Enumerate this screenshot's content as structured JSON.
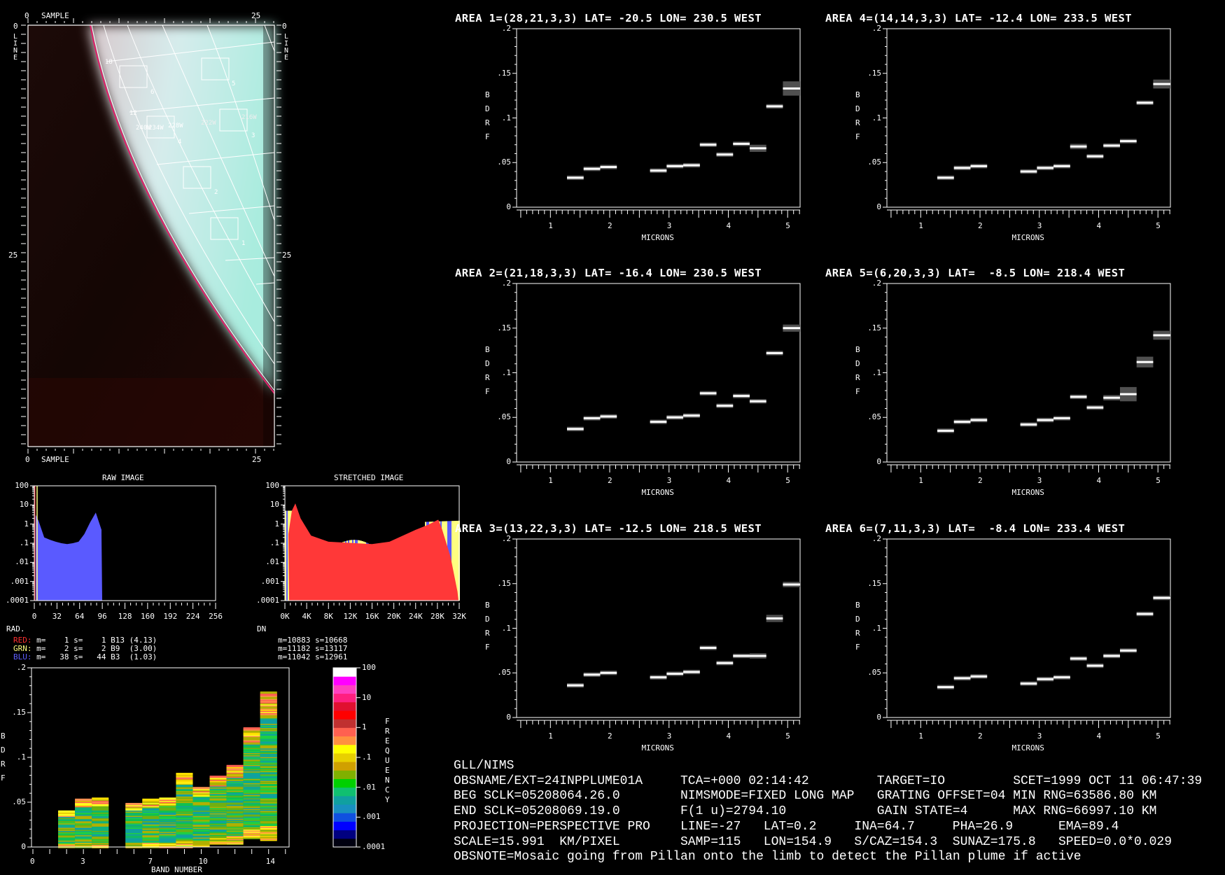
{
  "image_panel": {
    "top_label": "SAMPLE",
    "bottom_label": "SAMPLE",
    "side_label": "LINE",
    "tick_0": "0",
    "tick_25": "25",
    "grid_labels": [
      "18",
      "12",
      "240W",
      "234W",
      "228W",
      "222W",
      "216W"
    ],
    "box_labels": [
      "1",
      "2",
      "3",
      "4",
      "5",
      "6"
    ]
  },
  "raw_hist": {
    "title": "RAW IMAGE",
    "x_prefix": "RAD.",
    "x_ticks": [
      "0",
      "32",
      "64",
      "96",
      "128",
      "160",
      "192",
      "224",
      "256"
    ],
    "y_ticks": [
      "100",
      "10",
      "1",
      ".1",
      ".01",
      ".001",
      ".0001"
    ],
    "stats": [
      {
        "label": "RED:",
        "text": " m=    1 s=    1 B13 (4.13)",
        "color": "#ff3030"
      },
      {
        "label": "GRN:",
        "text": " m=    2 s=    2 B9  (3.00)",
        "color": "#ffff80"
      },
      {
        "label": "BLU:",
        "text": " m=   38 s=   44 B3  (1.03)",
        "color": "#6060ff"
      }
    ],
    "blue_log_freq": [
      1.5,
      0.2,
      0.15,
      0.12,
      0.1,
      0.09,
      0.1,
      0.12,
      0.3,
      1.2,
      4,
      0.5,
      0
    ]
  },
  "stretched_hist": {
    "title": "STRETCHED IMAGE",
    "x_prefix": "DN",
    "x_ticks": [
      "0K",
      "4K",
      "8K",
      "12K",
      "16K",
      "20K",
      "24K",
      "28K",
      "32K"
    ],
    "y_ticks": [
      "100",
      "10",
      "1",
      ".1",
      ".01",
      ".001",
      ".0001"
    ],
    "stats": [
      "m=10883 s=10668",
      "m=11182 s=13117",
      "m=11042 s=12961"
    ]
  },
  "band_chart": {
    "ylabel": "BDRF",
    "xlabel": "BAND NUMBER",
    "y_ticks": [
      "0",
      ".05",
      ".1",
      ".15",
      ".2"
    ],
    "x_ticks": [
      "0",
      "3",
      "7",
      "10",
      "14"
    ],
    "colorbar_ticks": [
      "100",
      "10",
      "1",
      ".1",
      ".01",
      ".001",
      ".0001"
    ],
    "colorbar_label": "FREQUENCY"
  },
  "chart_data": [
    {
      "type": "bar",
      "title": "AREA 1=(28,21,3,3) LAT= -20.5 LON= 230.5 WEST",
      "xlabel": "MICRONS",
      "ylabel": "BDRF",
      "ylim": [
        0,
        0.2
      ],
      "xlim": [
        0.43,
        5.21
      ],
      "values": [
        0.033,
        0.043,
        0.045,
        0.041,
        0.046,
        0.047,
        0.07,
        0.059,
        0.071,
        0.066,
        0.113,
        0.133
      ],
      "errors": [
        0.001,
        0.002,
        0.002,
        0.001,
        0.001,
        0.002,
        0.002,
        0.001,
        0.002,
        0.004,
        0.001,
        0.008
      ]
    },
    {
      "type": "bar",
      "title": "AREA 2=(21,18,3,3) LAT= -16.4 LON= 230.5 WEST",
      "xlabel": "MICRONS",
      "ylabel": "BDRF",
      "ylim": [
        0,
        0.2
      ],
      "xlim": [
        0.43,
        5.21
      ],
      "values": [
        0.037,
        0.049,
        0.051,
        0.045,
        0.05,
        0.052,
        0.077,
        0.063,
        0.074,
        0.068,
        0.122,
        0.15
      ],
      "errors": [
        0,
        0,
        0.001,
        0,
        0,
        0.001,
        0.001,
        0,
        0.001,
        0.001,
        0.001,
        0.004
      ]
    },
    {
      "type": "bar",
      "title": "AREA 3=(13,22,3,3) LAT= -12.5 LON= 218.5 WEST",
      "xlabel": "MICRONS",
      "ylabel": "BDRF",
      "ylim": [
        0,
        0.2
      ],
      "xlim": [
        0.43,
        5.21
      ],
      "values": [
        0.036,
        0.048,
        0.05,
        0.045,
        0.049,
        0.051,
        0.078,
        0.061,
        0.069,
        0.069,
        0.111,
        0.149
      ],
      "errors": [
        0,
        0,
        0.001,
        0,
        0,
        0.001,
        0.001,
        0,
        0.001,
        0.003,
        0.004,
        0.003
      ]
    },
    {
      "type": "bar",
      "title": "AREA 4=(14,14,3,3) LAT= -12.4 LON= 233.5 WEST",
      "xlabel": "MICRONS",
      "ylabel": "BDRF",
      "ylim": [
        0,
        0.2
      ],
      "xlim": [
        0.43,
        5.21
      ],
      "values": [
        0.033,
        0.044,
        0.046,
        0.04,
        0.044,
        0.046,
        0.068,
        0.057,
        0.069,
        0.074,
        0.117,
        0.138
      ],
      "errors": [
        0.001,
        0.001,
        0.002,
        0.002,
        0.001,
        0.001,
        0.003,
        0.001,
        0.001,
        0.001,
        0.001,
        0.005
      ]
    },
    {
      "type": "bar",
      "title": "AREA 5=(6,20,3,3) LAT=  -8.5 LON= 218.4 WEST",
      "xlabel": "MICRONS",
      "ylabel": "BDRF",
      "ylim": [
        0,
        0.2
      ],
      "xlim": [
        0.43,
        5.21
      ],
      "values": [
        0.035,
        0.045,
        0.047,
        0.042,
        0.047,
        0.049,
        0.073,
        0.061,
        0.072,
        0.076,
        0.112,
        0.142
      ],
      "errors": [
        0,
        0,
        0,
        0,
        0,
        0,
        0,
        0.001,
        0.003,
        0.008,
        0.006,
        0.005
      ]
    },
    {
      "type": "bar",
      "title": "AREA 6=(7,11,3,3) LAT=  -8.4 LON= 233.4 WEST",
      "xlabel": "MICRONS",
      "ylabel": "BDRF",
      "ylim": [
        0,
        0.2
      ],
      "xlim": [
        0.43,
        5.21
      ],
      "values": [
        0.034,
        0.044,
        0.046,
        0.038,
        0.043,
        0.045,
        0.066,
        0.058,
        0.069,
        0.075,
        0.116,
        0.134
      ],
      "errors": [
        0,
        0,
        0.001,
        0.001,
        0.001,
        0.001,
        0.002,
        0,
        0.001,
        0,
        0.002,
        0.001
      ]
    },
    {
      "type": "heatmap",
      "title": "",
      "xlabel": "BAND NUMBER",
      "ylabel": "BDRF",
      "ylim": [
        0,
        0.2
      ],
      "xlim": [
        0,
        15
      ],
      "bands": [
        2,
        3,
        4,
        6,
        7,
        8,
        9,
        10,
        11,
        12,
        13,
        14
      ],
      "ranges": [
        [
          0,
          0.04
        ],
        [
          0,
          0.053
        ],
        [
          0,
          0.055
        ],
        [
          0,
          0.049
        ],
        [
          0,
          0.053
        ],
        [
          0,
          0.055
        ],
        [
          0,
          0.082
        ],
        [
          0.001,
          0.067
        ],
        [
          0.004,
          0.079
        ],
        [
          0.004,
          0.091
        ],
        [
          0.01,
          0.133
        ],
        [
          0.008,
          0.173
        ]
      ]
    }
  ],
  "ytick_labels": [
    "0",
    ".05",
    ".1",
    ".15",
    ".2"
  ],
  "xtick_labels": [
    "1",
    "2",
    "3",
    "4",
    "5"
  ],
  "info": {
    "header": "GLL/NIMS",
    "rows": [
      [
        "OBSNAME/EXT=24INPPLUME01A",
        "TCA=+000 02:14:42",
        "TARGET=IO",
        "SCET=1999 OCT 11 06:47:39"
      ],
      [
        "BEG SCLK=05208064.26.0",
        "NIMSMODE=FIXED LONG MAP",
        "GRATING OFFSET=04",
        "MIN RNG=63586.80 KM"
      ],
      [
        "END SCLK=05208069.19.0",
        "F(1 u)=2794.10",
        "GAIN STATE=4",
        "MAX RNG=66997.10 KM"
      ]
    ],
    "row5": [
      "PROJECTION=PERSPECTIVE PRO",
      "LINE=-27",
      "LAT=0.2",
      "INA=64.7",
      "PHA=26.9",
      "EMA=89.4"
    ],
    "row6": [
      "SCALE=15.991  KM/PIXEL",
      "SAMP=115",
      "LON=154.9",
      "S/CAZ=154.3",
      "SUNAZ=175.8",
      "SPEED=0.0*0.029"
    ],
    "obsnote": "OBSNOTE=Mosaic going from Pillan onto the limb to detect the Pillan plume if active"
  }
}
